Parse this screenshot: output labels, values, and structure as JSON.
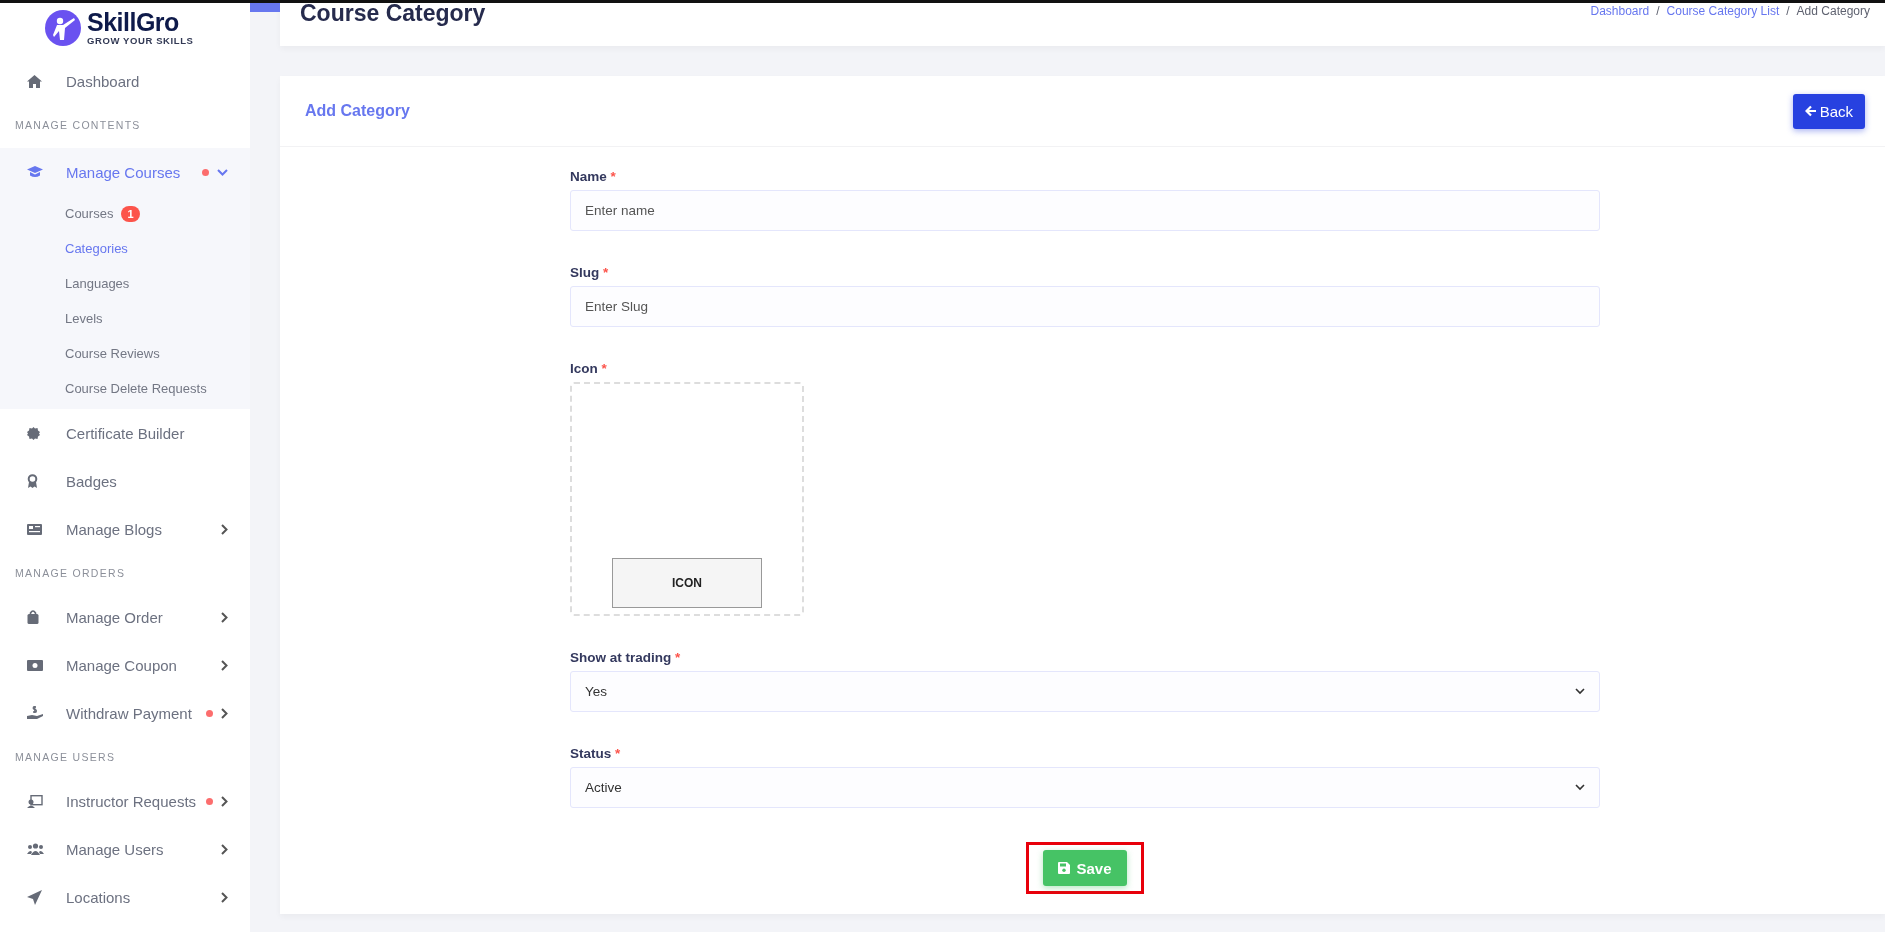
{
  "brand": {
    "name": "SkillGro",
    "tagline": "GROW YOUR SKILLS"
  },
  "sidebar": [
    {
      "kind": "item",
      "label": "Dashboard",
      "selected": false
    },
    {
      "kind": "section",
      "label": "MANAGE CONTENTS"
    },
    {
      "kind": "group",
      "label": "Manage Courses",
      "selected": true,
      "dot": true,
      "expanded": true,
      "children": [
        {
          "label": "Courses",
          "selected": false,
          "badge": "1"
        },
        {
          "label": "Categories",
          "selected": true
        },
        {
          "label": "Languages",
          "selected": false
        },
        {
          "label": "Levels",
          "selected": false
        },
        {
          "label": "Course Reviews",
          "selected": false
        },
        {
          "label": "Course Delete Requests",
          "selected": false
        }
      ]
    },
    {
      "kind": "item",
      "label": "Certificate Builder",
      "selected": false
    },
    {
      "kind": "item",
      "label": "Badges",
      "selected": false
    },
    {
      "kind": "item",
      "label": "Manage Blogs",
      "selected": false,
      "expanded": false
    },
    {
      "kind": "section",
      "label": "MANAGE ORDERS"
    },
    {
      "kind": "item",
      "label": "Manage Order",
      "selected": false,
      "expanded": false
    },
    {
      "kind": "item",
      "label": "Manage Coupon",
      "selected": false,
      "expanded": false
    },
    {
      "kind": "item",
      "label": "Withdraw Payment",
      "selected": false,
      "dot": true,
      "expanded": false
    },
    {
      "kind": "section",
      "label": "MANAGE USERS"
    },
    {
      "kind": "item",
      "label": "Instructor Requests",
      "selected": false,
      "dot": true,
      "expanded": false
    },
    {
      "kind": "item",
      "label": "Manage Users",
      "selected": false,
      "expanded": false
    },
    {
      "kind": "item",
      "label": "Locations",
      "selected": false,
      "expanded": false
    }
  ],
  "page_title": "Course Category",
  "breadcrumb": [
    {
      "label": "Dashboard",
      "link": true
    },
    {
      "label": "/",
      "link": false
    },
    {
      "label": "Course Category List",
      "link": true
    },
    {
      "label": "/",
      "link": false
    },
    {
      "label": "Add Category",
      "link": false
    }
  ],
  "card": {
    "title": "Add Category",
    "back_button": "Back"
  },
  "fields": [
    {
      "kind": "text",
      "label": "Name",
      "required_mark": "*",
      "placeholder": "Enter name"
    },
    {
      "kind": "text",
      "label": "Slug",
      "required_mark": "*",
      "placeholder": "Enter Slug"
    },
    {
      "kind": "image",
      "label": "Icon",
      "required_mark": "*",
      "button": "ICON"
    },
    {
      "kind": "select",
      "label": "Show at trading",
      "required_mark": "*",
      "value": "Yes"
    },
    {
      "kind": "select",
      "label": "Status",
      "required_mark": "*",
      "value": "Active"
    }
  ],
  "save_button": {
    "label": "Save",
    "highlighted": true
  }
}
